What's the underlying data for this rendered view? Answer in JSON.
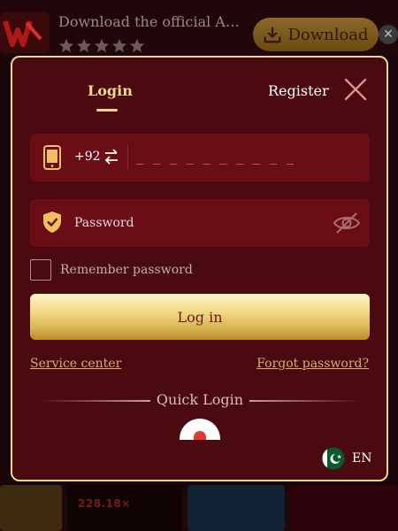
{
  "banner": {
    "title": "Download the official APP t...",
    "rating_stars": 5,
    "download_label": "Download",
    "close_symbol": "✕"
  },
  "background": {
    "multiplier_text": "228.18×"
  },
  "modal": {
    "tabs": {
      "login": "Login",
      "register": "Register",
      "active": "login"
    },
    "phone": {
      "country_code": "+92",
      "placeholder": "_ _ _ _ _ _ _ _ _ _",
      "icon": "phone-icon",
      "swap_icon": "swap-arrows-icon"
    },
    "password": {
      "placeholder": "Password",
      "icon": "shield-check-icon",
      "visibility_icon": "eye-off-icon"
    },
    "remember": {
      "label": "Remember password",
      "checked": false
    },
    "login_button": "Log in",
    "links": {
      "service_center": "Service center",
      "forgot_password": "Forgot password?"
    },
    "quick_login": {
      "label": "Quick Login",
      "providers": [
        "google-icon"
      ]
    },
    "language": {
      "code": "EN",
      "flag": "pakistan-flag-icon"
    }
  },
  "colors": {
    "accent_gold": "#f0d98a",
    "modal_bg": "#4a0a10",
    "field_bg": "#6a0d15",
    "link": "#d6b070"
  }
}
